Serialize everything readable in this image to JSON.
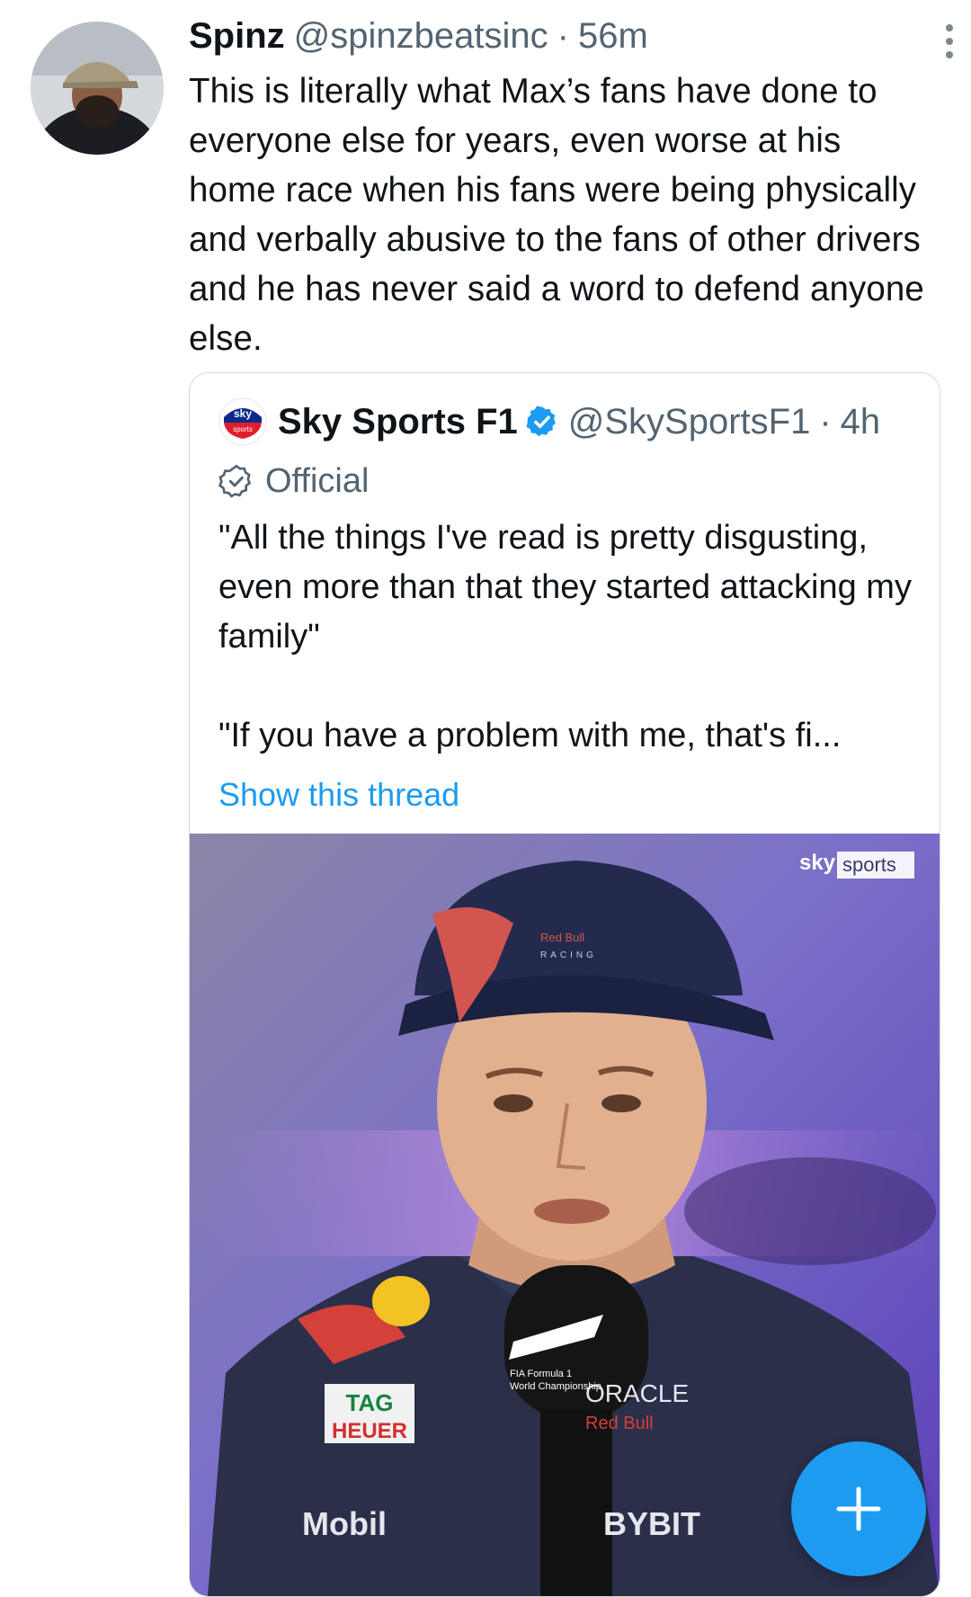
{
  "tweet": {
    "author_name": "Spinz",
    "author_handle": "@spinzbeatsinc",
    "separator": "·",
    "timestamp": "56m",
    "text": "This is literally what Max’s fans have done to everyone else for years, even worse at his home race when his fans were being physically and verbally abusive to the fans of other drivers and he has never said a word to defend anyone else."
  },
  "quote": {
    "author_name": "Sky Sports F1",
    "author_handle": "@SkySportsF1",
    "separator": "·",
    "timestamp": "4h",
    "badge_label": "Official",
    "paragraph_1": "\"All the things I've read is pretty disgusting, even more than that they started attacking my family\"",
    "paragraph_2": "\"If you have a problem with me, that's fi...",
    "show_thread": "Show this thread",
    "media": {
      "watermark_brand": "sky",
      "watermark_channel": "sports"
    }
  },
  "colors": {
    "link": "#1d9bf0",
    "secondary_text": "#536471",
    "fab": "#1d9bf0",
    "verified": "#1d9bf0"
  },
  "icons": [
    "more-vertical-icon",
    "verified-badge-icon",
    "official-badge-icon",
    "plus-icon"
  ]
}
